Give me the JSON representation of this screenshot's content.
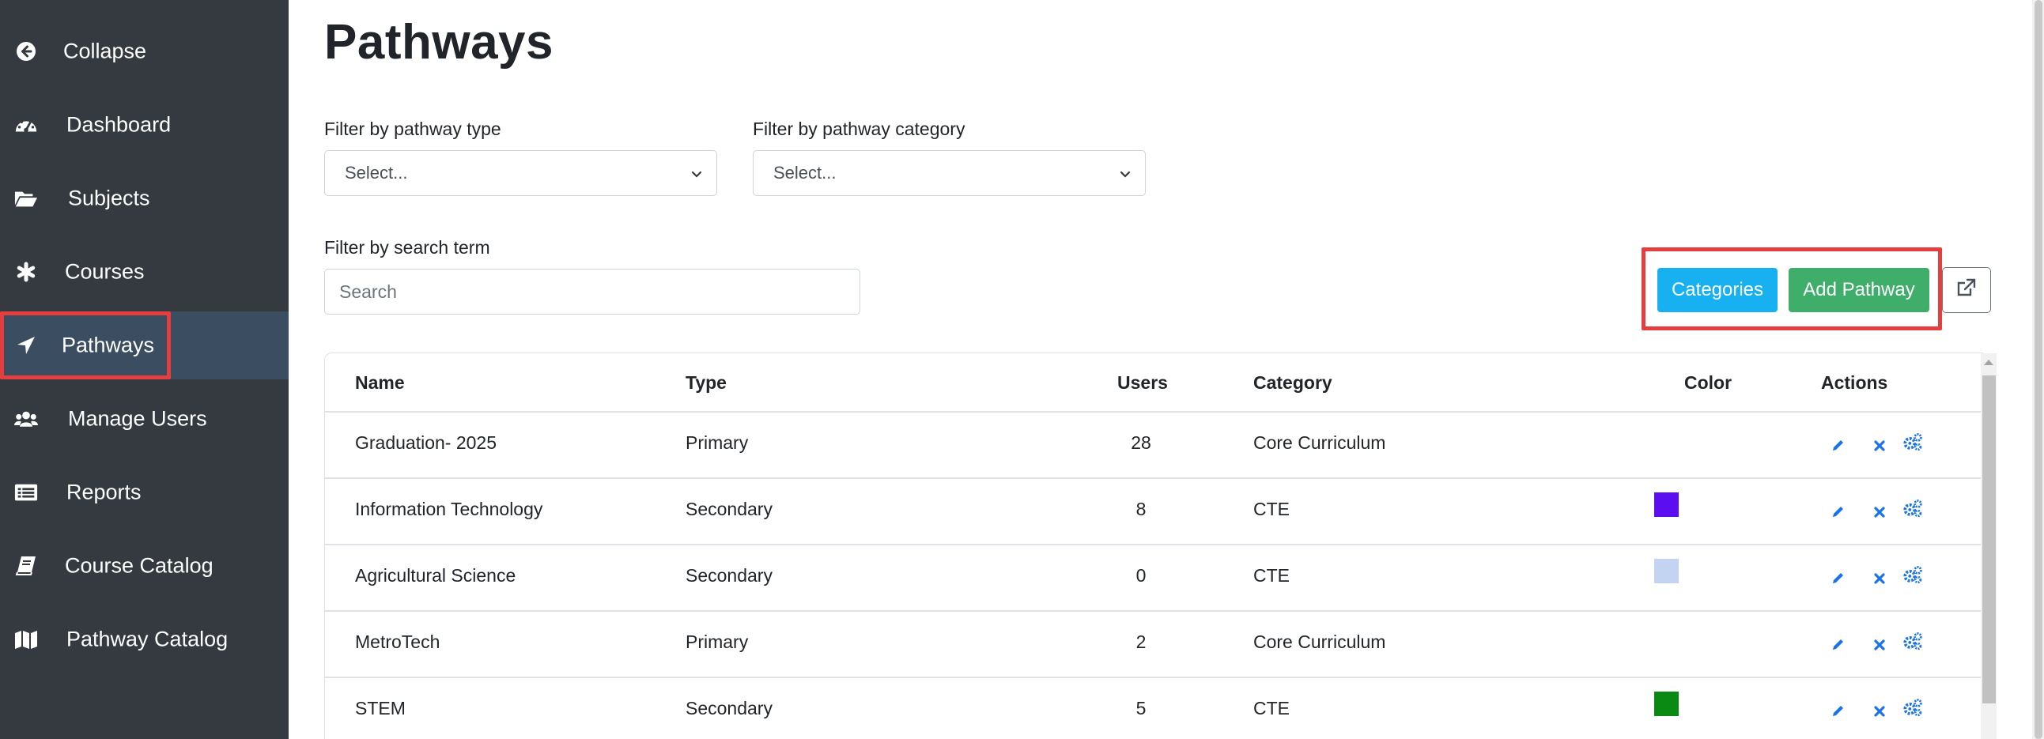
{
  "sidebar": {
    "items": [
      {
        "label": "Collapse",
        "icon": "arrow-circle-left-icon"
      },
      {
        "label": "Dashboard",
        "icon": "tachometer-icon"
      },
      {
        "label": "Subjects",
        "icon": "folder-open-icon"
      },
      {
        "label": "Courses",
        "icon": "asterisk-icon"
      },
      {
        "label": "Pathways",
        "icon": "location-arrow-icon",
        "active": true
      },
      {
        "label": "Manage Users",
        "icon": "users-icon"
      },
      {
        "label": "Reports",
        "icon": "list-alt-icon"
      },
      {
        "label": "Course Catalog",
        "icon": "book-icon"
      },
      {
        "label": "Pathway Catalog",
        "icon": "map-icon"
      }
    ]
  },
  "page": {
    "title": "Pathways"
  },
  "filters": {
    "type_label": "Filter by pathway type",
    "type_value": "Select...",
    "category_label": "Filter by pathway category",
    "category_value": "Select...",
    "search_label": "Filter by search term",
    "search_placeholder": "Search"
  },
  "toolbar": {
    "categories_label": "Categories",
    "add_label": "Add Pathway",
    "external_icon": "external-link-icon"
  },
  "table": {
    "headers": [
      "Name",
      "Type",
      "Users",
      "Category",
      "Color",
      "Actions"
    ],
    "rows": [
      {
        "name": "Graduation- 2025",
        "type": "Primary",
        "users": "28",
        "category": "Core Curriculum",
        "color": ""
      },
      {
        "name": "Information Technology",
        "type": "Secondary",
        "users": "8",
        "category": "CTE",
        "color": "#5b0ef0"
      },
      {
        "name": "Agricultural Science",
        "type": "Secondary",
        "users": "0",
        "category": "CTE",
        "color": "#c3d4f2"
      },
      {
        "name": "MetroTech",
        "type": "Primary",
        "users": "2",
        "category": "Core Curriculum",
        "color": ""
      },
      {
        "name": "STEM",
        "type": "Secondary",
        "users": "5",
        "category": "CTE",
        "color": "#0a8a12"
      }
    ],
    "action_icons": [
      "pencil-icon",
      "close-icon",
      "cogs-icon"
    ]
  },
  "colors": {
    "sidebar_bg": "#343a40",
    "sidebar_active": "#3b4d61",
    "highlight": "#e53e3e",
    "info": "#17b0f0",
    "success": "#3fae6a",
    "link": "#1a73e8"
  }
}
